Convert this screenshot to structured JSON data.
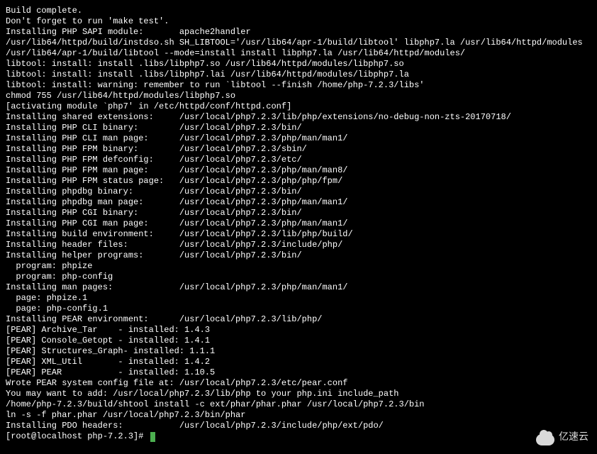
{
  "lines": [
    "Build complete.",
    "Don't forget to run 'make test'.",
    "",
    "Installing PHP SAPI module:       apache2handler",
    "/usr/lib64/httpd/build/instdso.sh SH_LIBTOOL='/usr/lib64/apr-1/build/libtool' libphp7.la /usr/lib64/httpd/modules",
    "/usr/lib64/apr-1/build/libtool --mode=install install libphp7.la /usr/lib64/httpd/modules/",
    "libtool: install: install .libs/libphp7.so /usr/lib64/httpd/modules/libphp7.so",
    "libtool: install: install .libs/libphp7.lai /usr/lib64/httpd/modules/libphp7.la",
    "libtool: install: warning: remember to run `libtool --finish /home/php-7.2.3/libs'",
    "chmod 755 /usr/lib64/httpd/modules/libphp7.so",
    "[activating module `php7' in /etc/httpd/conf/httpd.conf]",
    "Installing shared extensions:     /usr/local/php7.2.3/lib/php/extensions/no-debug-non-zts-20170718/",
    "Installing PHP CLI binary:        /usr/local/php7.2.3/bin/",
    "Installing PHP CLI man page:      /usr/local/php7.2.3/php/man/man1/",
    "Installing PHP FPM binary:        /usr/local/php7.2.3/sbin/",
    "Installing PHP FPM defconfig:     /usr/local/php7.2.3/etc/",
    "Installing PHP FPM man page:      /usr/local/php7.2.3/php/man/man8/",
    "Installing PHP FPM status page:   /usr/local/php7.2.3/php/php/fpm/",
    "Installing phpdbg binary:         /usr/local/php7.2.3/bin/",
    "Installing phpdbg man page:       /usr/local/php7.2.3/php/man/man1/",
    "Installing PHP CGI binary:        /usr/local/php7.2.3/bin/",
    "Installing PHP CGI man page:      /usr/local/php7.2.3/php/man/man1/",
    "Installing build environment:     /usr/local/php7.2.3/lib/php/build/",
    "Installing header files:          /usr/local/php7.2.3/include/php/",
    "Installing helper programs:       /usr/local/php7.2.3/bin/",
    "  program: phpize",
    "  program: php-config",
    "Installing man pages:             /usr/local/php7.2.3/php/man/man1/",
    "  page: phpize.1",
    "  page: php-config.1",
    "Installing PEAR environment:      /usr/local/php7.2.3/lib/php/",
    "[PEAR] Archive_Tar    - installed: 1.4.3",
    "[PEAR] Console_Getopt - installed: 1.4.1",
    "[PEAR] Structures_Graph- installed: 1.1.1",
    "[PEAR] XML_Util       - installed: 1.4.2",
    "[PEAR] PEAR           - installed: 1.10.5",
    "Wrote PEAR system config file at: /usr/local/php7.2.3/etc/pear.conf",
    "You may want to add: /usr/local/php7.2.3/lib/php to your php.ini include_path",
    "/home/php-7.2.3/build/shtool install -c ext/phar/phar.phar /usr/local/php7.2.3/bin",
    "ln -s -f phar.phar /usr/local/php7.2.3/bin/phar",
    "Installing PDO headers:           /usr/local/php7.2.3/include/php/ext/pdo/"
  ],
  "prompt": "[root@localhost php-7.2.3]# ",
  "watermark": "亿速云"
}
